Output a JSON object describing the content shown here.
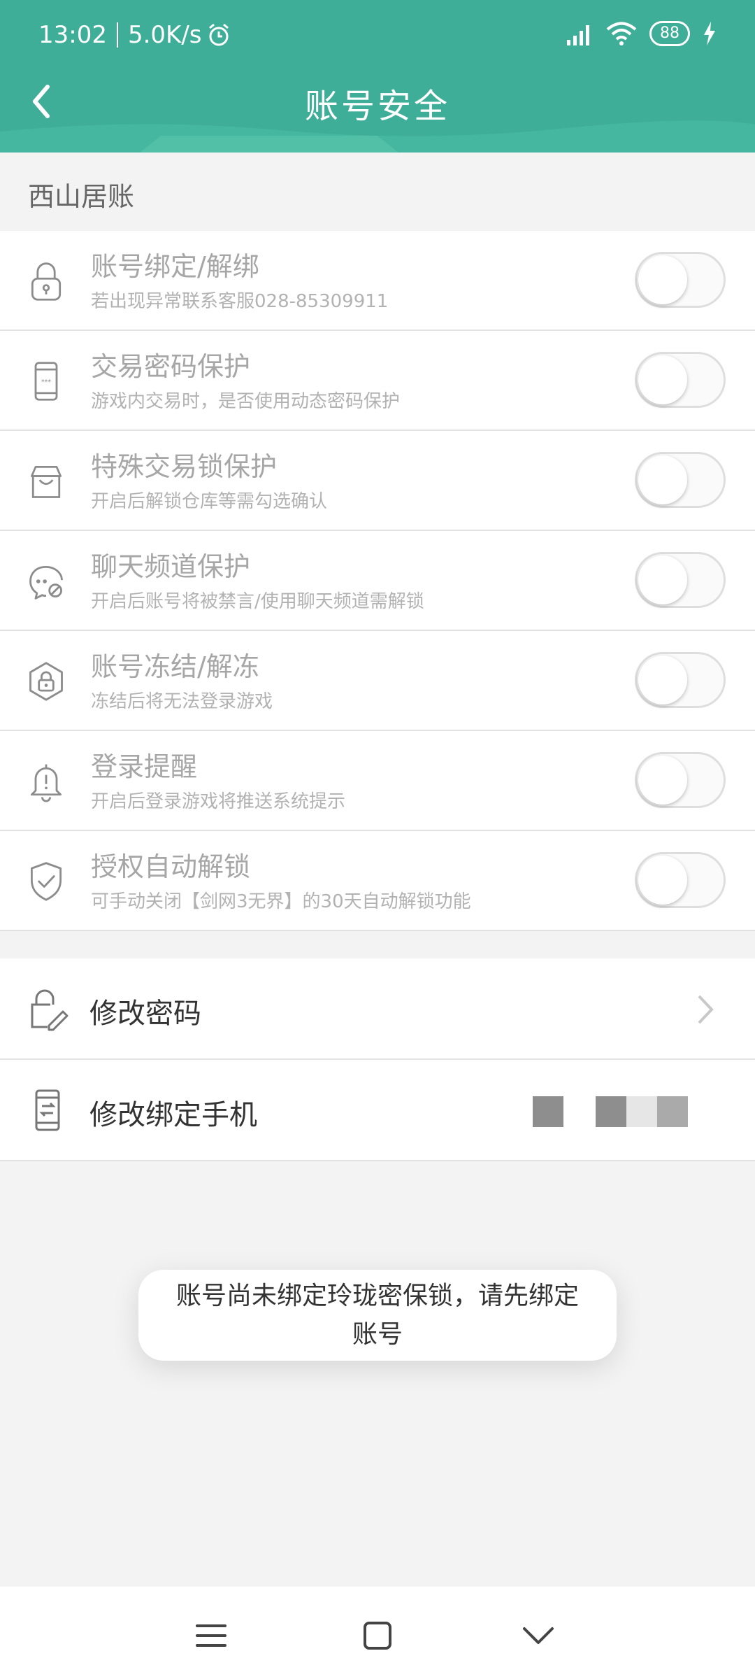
{
  "status_bar": {
    "time": "13:02",
    "speed": "5.0K/s",
    "battery": "88"
  },
  "header": {
    "title": "账号安全"
  },
  "section_label": "西山居账",
  "toggles": [
    {
      "title": "账号绑定/解绑",
      "subtitle": "若出现异常联系客服028-85309911",
      "icon": "lock-icon",
      "enabled": false
    },
    {
      "title": "交易密码保护",
      "subtitle": "游戏内交易时，是否使用动态密码保护",
      "icon": "phone-password-icon",
      "enabled": false
    },
    {
      "title": "特殊交易锁保护",
      "subtitle": "开启后解锁仓库等需勾选确认",
      "icon": "store-icon",
      "enabled": false
    },
    {
      "title": "聊天频道保护",
      "subtitle": "开启后账号将被禁言/使用聊天频道需解锁",
      "icon": "chat-blocked-icon",
      "enabled": false
    },
    {
      "title": "账号冻结/解冻",
      "subtitle": "冻结后将无法登录游戏",
      "icon": "freeze-lock-icon",
      "enabled": false
    },
    {
      "title": "登录提醒",
      "subtitle": "开启后登录游戏将推送系统提示",
      "icon": "bell-alert-icon",
      "enabled": false
    },
    {
      "title": "授权自动解锁",
      "subtitle": "可手动关闭【剑网3无界】的30天自动解锁功能",
      "icon": "shield-check-icon",
      "enabled": false
    }
  ],
  "actions": [
    {
      "label": "修改密码",
      "icon": "lock-edit-icon"
    },
    {
      "label": "修改绑定手机",
      "icon": "phone-swap-icon"
    }
  ],
  "toast": {
    "line1": "账号尚未绑定玲珑密保锁，请先绑定",
    "line2": "账号"
  },
  "colors": {
    "header": "#3fae98",
    "background": "#f3f3f3"
  }
}
